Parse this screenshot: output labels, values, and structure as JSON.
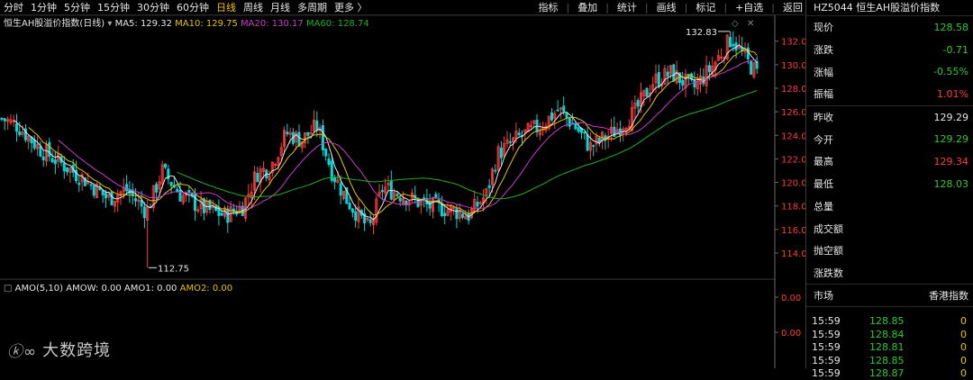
{
  "toolbar": {
    "periods": [
      "分时",
      "1分钟",
      "5分钟",
      "15分钟",
      "30分钟",
      "60分钟",
      "日线",
      "周线",
      "月线",
      "多周期",
      "更多 〉"
    ],
    "active": "日线",
    "right": [
      "指标",
      "叠加",
      "统计",
      "画线",
      "标记",
      "+自选",
      "返回"
    ]
  },
  "main_legend": {
    "name": "恒生AH股溢价指数(日线)",
    "ma5": "MA5: 129.32",
    "ma10": "MA10: 129.75",
    "ma20": "MA20: 130.17",
    "ma60": "MA60: 128.74"
  },
  "sub_legend": {
    "amo": "AMO(5,10)",
    "amow": "AMOW: 0.00",
    "amo1": "AMO1: 0.00",
    "amo2": "AMO2: 0.00"
  },
  "annotations": {
    "high": "132.83",
    "low": "112.75"
  },
  "axis": {
    "price_ticks": [
      "132.0",
      "130.0",
      "128.0",
      "126.0",
      "124.0",
      "122.0",
      "120.0",
      "118.0",
      "116.0",
      "114.0"
    ],
    "sub_ticks": [
      "0.00",
      "0.00"
    ]
  },
  "colors": {
    "up": "#ff3c3c",
    "down": "#00d8d8",
    "ma5": "#e6e6e6",
    "ma10": "#e8c200",
    "ma20": "#c83cc8",
    "ma60": "#20b020"
  },
  "panel": {
    "title": "HZ5044  恒生AH股溢价指数",
    "quotes": [
      {
        "label": "现价",
        "value": "128.58",
        "color": "green"
      },
      {
        "label": "涨跌",
        "value": "-0.71",
        "color": "green"
      },
      {
        "label": "涨幅",
        "value": "-0.55%",
        "color": "green"
      },
      {
        "label": "振幅",
        "value": "1.01%",
        "color": "red"
      }
    ],
    "stats": [
      {
        "label": "昨收",
        "value": "129.29",
        "color": "white"
      },
      {
        "label": "今开",
        "value": "129.29",
        "color": "green"
      },
      {
        "label": "最高",
        "value": "129.34",
        "color": "red"
      },
      {
        "label": "最低",
        "value": "128.03",
        "color": "green"
      },
      {
        "label": "总量",
        "value": "",
        "color": "white"
      },
      {
        "label": "成交额",
        "value": "",
        "color": "white"
      },
      {
        "label": "抛空额",
        "value": "",
        "color": "white"
      },
      {
        "label": "涨跌数",
        "value": "",
        "color": "white"
      }
    ],
    "market_label": "市场",
    "market_value": "香港指数",
    "ticks": [
      {
        "time": "15:59",
        "price": "128.85",
        "vol": "0"
      },
      {
        "time": "15:59",
        "price": "128.84",
        "vol": "0"
      },
      {
        "time": "15:59",
        "price": "128.81",
        "vol": "0"
      },
      {
        "time": "15:59",
        "price": "128.85",
        "vol": "0"
      },
      {
        "time": "15:59",
        "price": "128.87",
        "vol": "0"
      }
    ]
  },
  "logo": {
    "text": "大数跨境"
  }
}
